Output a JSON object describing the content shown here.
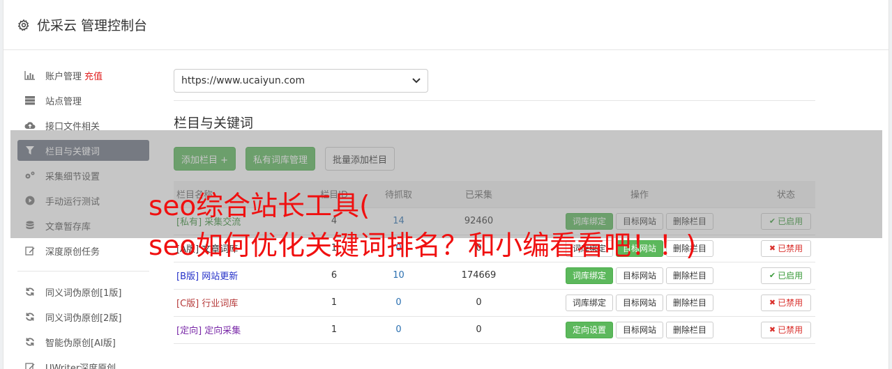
{
  "header": {
    "title": "优采云 管理控制台",
    "icon": "gear-icon"
  },
  "sidebar": {
    "items": [
      {
        "label": "账户管理",
        "extra": "充值",
        "icon": "bar-chart-icon"
      },
      {
        "label": "站点管理",
        "icon": "server-icon"
      },
      {
        "label": "接口文件相关",
        "icon": "cloud-upload-icon"
      },
      {
        "label": "栏目与关键词",
        "icon": "filter-icon",
        "active": true
      },
      {
        "label": "采集细节设置",
        "icon": "cogs-icon"
      },
      {
        "label": "手动运行测试",
        "icon": "play-circle-icon"
      },
      {
        "label": "文章暂存库",
        "icon": "database-icon"
      },
      {
        "label": "深度原创任务",
        "icon": "edit-icon"
      }
    ],
    "items2": [
      {
        "label": "同义词伪原创[1版]",
        "icon": "refresh-icon"
      },
      {
        "label": "同义词伪原创[2版]",
        "icon": "refresh-icon"
      },
      {
        "label": "智能伪原创[AI版]",
        "icon": "refresh-icon"
      },
      {
        "label": "UWriter深度原创",
        "icon": "edit-icon"
      }
    ]
  },
  "main": {
    "site_select": {
      "value": "https://www.ucaiyun.com"
    },
    "section_title": "栏目与关键词",
    "buttons": {
      "add": "添加栏目 +",
      "private": "私有词库管理",
      "batch": "批量添加栏目"
    },
    "table": {
      "headers": [
        "栏目名称",
        "栏目ID",
        "待抓取",
        "已采集",
        "操作",
        "状态"
      ],
      "rows": [
        {
          "tag": "[私有]",
          "name": "采集交流",
          "id": "4",
          "pending": "14",
          "collected": "92460",
          "op1": "词库绑定",
          "op1_green": true,
          "op2": "目标网站",
          "op3": "删除栏目",
          "status": "已启用",
          "on": true,
          "tagclass": "tag-private"
        },
        {
          "tag": "[A版]",
          "name": "文章词库",
          "id": "1",
          "pending": "0",
          "collected": "0",
          "op1": "词库绑定",
          "op1_green": false,
          "op2": "目标网站",
          "op2_green": true,
          "op3": "删除栏目",
          "status": "已禁用",
          "on": false,
          "tagclass": "tag-a"
        },
        {
          "tag": "[B版]",
          "name": "网站更新",
          "id": "6",
          "pending": "10",
          "collected": "174669",
          "op1": "词库绑定",
          "op1_green": true,
          "op2": "目标网站",
          "op3": "删除栏目",
          "status": "已启用",
          "on": true,
          "tagclass": "tag-b"
        },
        {
          "tag": "[C版]",
          "name": "行业词库",
          "id": "1",
          "pending": "0",
          "collected": "0",
          "op1": "词库绑定",
          "op1_green": false,
          "op2": "目标网站",
          "op3": "删除栏目",
          "status": "已禁用",
          "on": false,
          "tagclass": "tag-c"
        },
        {
          "tag": "[定向]",
          "name": "定向采集",
          "id": "1",
          "pending": "0",
          "collected": "0",
          "op1": "定向设置",
          "op1_green": true,
          "op2": "目标网站",
          "op3": "删除栏目",
          "status": "已禁用",
          "on": false,
          "tagclass": "tag-dir"
        }
      ]
    }
  },
  "watermark": {
    "line1": "seo综合站长工具(",
    "line2": "seo如何优化关键词排名？和小编看看吧！！)"
  },
  "colors": {
    "accent_green": "#5cb85c",
    "active_nav": "#6e7584",
    "watermark": "#f01010"
  }
}
